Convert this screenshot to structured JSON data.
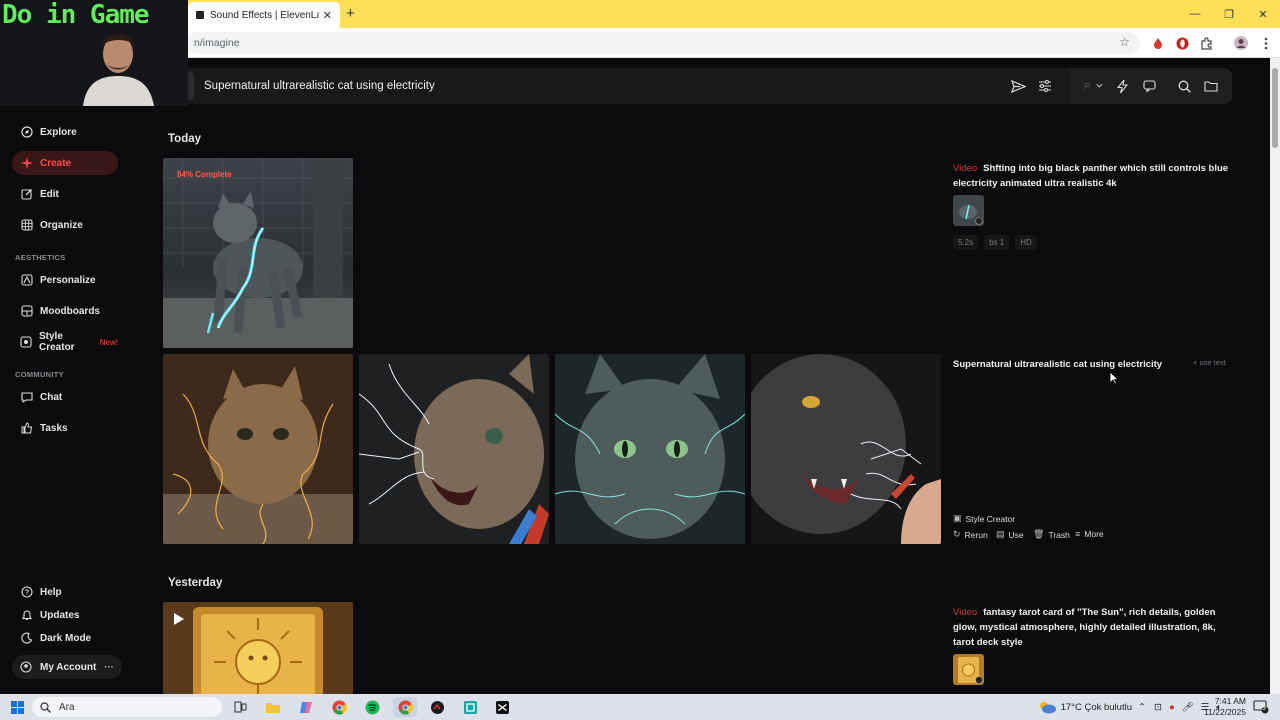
{
  "browser": {
    "tab_title": "Sound Effects | ElevenLabs",
    "tab_close": "✕",
    "new_tab": "+",
    "url": "n/imagine",
    "window": {
      "minimize": "—",
      "restore": "❐",
      "close": "✕"
    }
  },
  "overlay": {
    "brand": "Do in Game"
  },
  "topbar": {
    "prompt": "Supernatural ultrarealistic cat using electricity"
  },
  "sidebar": {
    "main": [
      {
        "label": "Explore",
        "icon": "compass-icon"
      },
      {
        "label": "Create",
        "icon": "sparkle-icon"
      },
      {
        "label": "Edit",
        "icon": "edit-icon"
      },
      {
        "label": "Organize",
        "icon": "grid-icon"
      }
    ],
    "aesthetics_header": "AESTHETICS",
    "aesthetics": [
      {
        "label": "Personalize",
        "icon": "personalize-icon"
      },
      {
        "label": "Moodboards",
        "icon": "moodboard-icon"
      },
      {
        "label": "Style Creator",
        "icon": "palette-icon",
        "badge": "New!"
      }
    ],
    "community_header": "COMMUNITY",
    "community": [
      {
        "label": "Chat",
        "icon": "chat-icon"
      },
      {
        "label": "Tasks",
        "icon": "thumb-icon"
      }
    ],
    "bottom": [
      {
        "label": "Help",
        "icon": "help-icon"
      },
      {
        "label": "Updates",
        "icon": "bell-icon"
      },
      {
        "label": "Dark Mode",
        "icon": "moon-icon"
      }
    ],
    "account": "My Account",
    "account_more": "···"
  },
  "feed": {
    "today": "Today",
    "yesterday": "Yesterday",
    "progress_badge": "84% Complete",
    "job1": {
      "tag": "Video",
      "prompt": "Shfting into big black panther which still controls blue electricity animated ultra realistic 4k",
      "chips": [
        "5.2s",
        "bs 1",
        "HD"
      ]
    },
    "job2": {
      "prompt": "Supernatural ultrarealistic cat using electricity",
      "use_text": "+ use text",
      "style_creator": "Style Creator",
      "actions": [
        "Rerun",
        "Use",
        "Trash",
        "More"
      ]
    },
    "job3": {
      "tag": "Video",
      "prompt": "fantasy tarot card of \"The Sun\", rich details, golden glow, mystical atmosphere, highly detailed illustration, 8k, tarot deck style"
    }
  },
  "taskbar": {
    "search": "Ara",
    "weather": "17°C  Çok bulutlu",
    "time": "7:41 AM",
    "date": "11/22/2025",
    "notif": "9"
  },
  "colors": {
    "accent": "#ff4b4b",
    "video_tag": "#d23b34",
    "brand_green": "#5ef05a"
  }
}
